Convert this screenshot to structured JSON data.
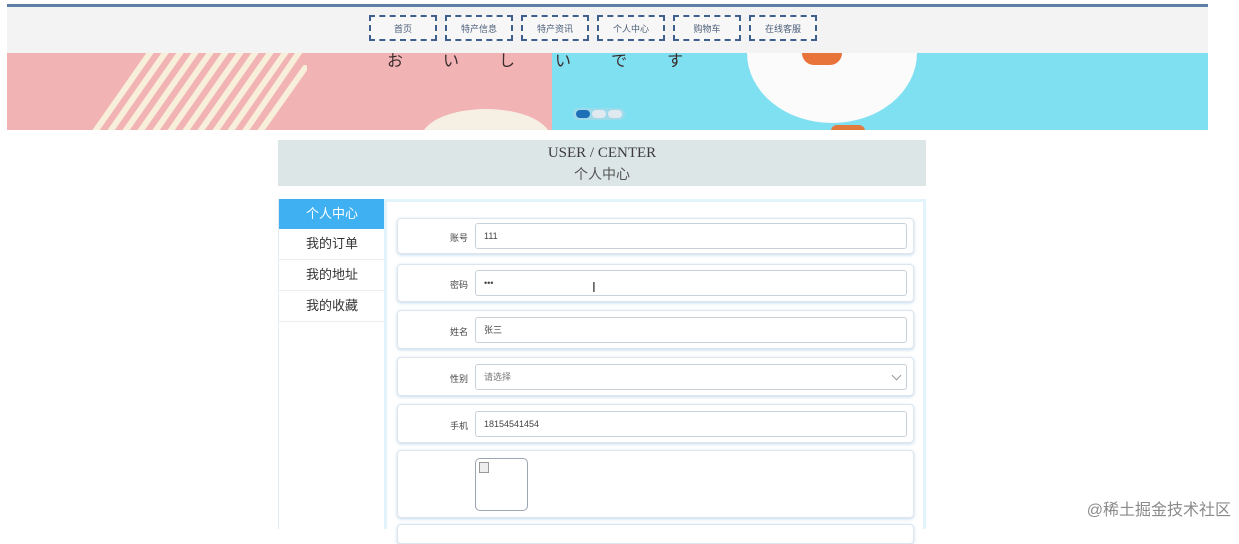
{
  "nav": {
    "items": [
      "首页",
      "特产信息",
      "特产资讯",
      "个人中心",
      "购物车",
      "在线客服"
    ]
  },
  "banner": {
    "text": [
      "お",
      "い",
      "し",
      "い",
      "で",
      "す"
    ],
    "active_slide": 1,
    "slide_count": 3
  },
  "header": {
    "title_en": "USER / CENTER",
    "title_cn": "个人中心"
  },
  "sidebar": {
    "items": [
      "个人中心",
      "我的订单",
      "我的地址",
      "我的收藏"
    ],
    "active": "个人中心"
  },
  "form": {
    "account": {
      "label": "账号",
      "value": "111"
    },
    "password": {
      "label": "密码",
      "value": "•••"
    },
    "name": {
      "label": "姓名",
      "value": "张三"
    },
    "gender": {
      "label": "性别",
      "value": "请选择"
    },
    "phone": {
      "label": "手机",
      "value": "18154541454"
    }
  },
  "watermark": "@稀土掘金技术社区",
  "colors": {
    "accent": "#3fb1f2",
    "nav_border": "#3f5f8f",
    "banner_pink": "#f2b3b5",
    "banner_blue": "#7fe0f2"
  }
}
